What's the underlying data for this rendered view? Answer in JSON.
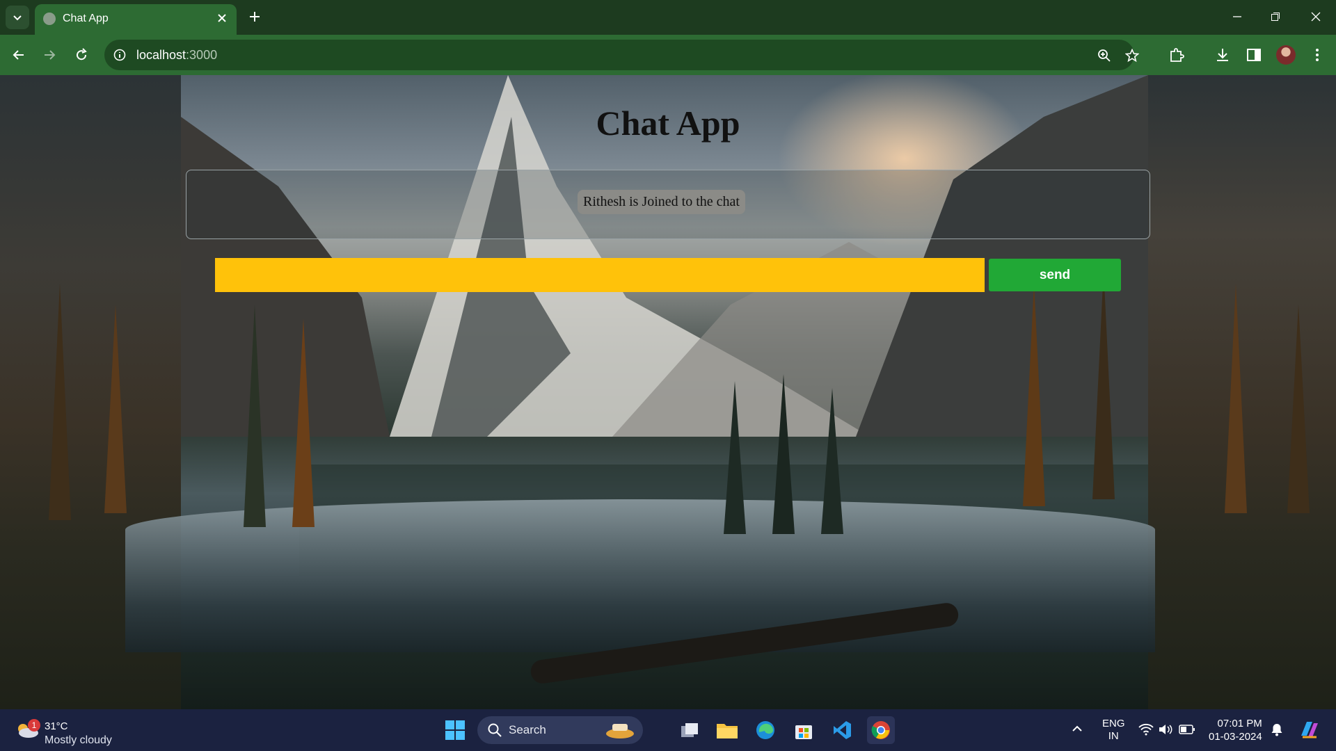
{
  "browser": {
    "tab_title": "Chat App",
    "url_host": "localhost",
    "url_port": ":3000"
  },
  "page": {
    "title": "Chat App",
    "messages": [
      "Rithesh is Joined to the chat"
    ],
    "input_value": "",
    "send_label": "send",
    "colors": {
      "input": "#ffc20a",
      "send": "#21a836"
    }
  },
  "taskbar": {
    "weather_badge": "1",
    "temperature": "31°C",
    "weather_desc": "Mostly cloudy",
    "search_label": "Search",
    "lang_top": "ENG",
    "lang_bottom": "IN",
    "time": "07:01 PM",
    "date": "01-03-2024"
  }
}
